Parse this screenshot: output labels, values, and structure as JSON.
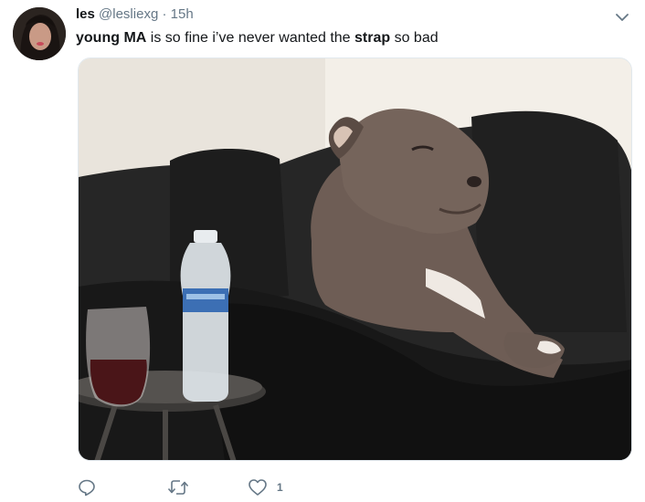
{
  "tweet": {
    "display_name": "les",
    "handle": "@lesliexg",
    "separator": "·",
    "timestamp": "15h",
    "text_parts": [
      {
        "text": "young MA",
        "bold": true
      },
      {
        "text": " is so fine i’ve never wanted the ",
        "bold": false
      },
      {
        "text": "strap",
        "bold": true
      },
      {
        "text": " so bad",
        "bold": false
      }
    ]
  },
  "actions": {
    "reply": {
      "icon": "reply-icon"
    },
    "retweet": {
      "icon": "retweet-icon"
    },
    "like": {
      "icon": "heart-icon",
      "count": "1"
    }
  },
  "colors": {
    "text": "#14171a",
    "muted": "#657786",
    "border": "#e1e8ed"
  }
}
